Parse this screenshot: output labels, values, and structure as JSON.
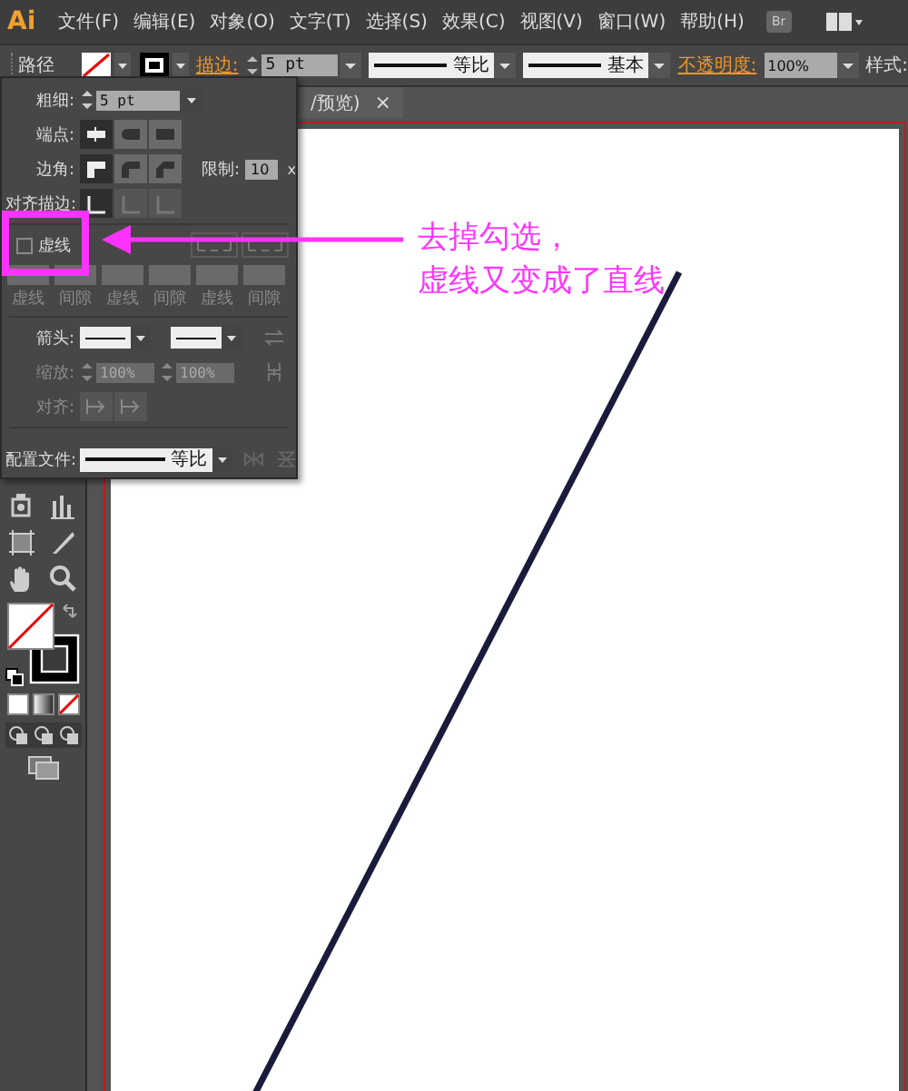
{
  "menu_bar": {
    "logo": "Ai",
    "items": [
      "文件(F)",
      "编辑(E)",
      "对象(O)",
      "文字(T)",
      "选择(S)",
      "效果(C)",
      "视图(V)",
      "窗口(W)",
      "帮助(H)"
    ],
    "bridge_button": "Br"
  },
  "control_bar": {
    "object_type": "路径",
    "stroke_label": "描边:",
    "stroke_weight": "5 pt",
    "variable_width": "等比",
    "brush": "基本",
    "opacity_label": "不透明度:",
    "opacity": "100%",
    "style_label": "样式:"
  },
  "document_tab": {
    "title": "/预览)",
    "close": "×"
  },
  "stroke_panel": {
    "weight_label": "粗细:",
    "weight": "5 pt",
    "cap_label": "端点:",
    "caps": [
      {
        "selected": true
      },
      {
        "selected": false
      },
      {
        "selected": false
      }
    ],
    "corner_label": "边角:",
    "corners": [
      {
        "selected": true
      },
      {
        "selected": false
      },
      {
        "selected": false
      }
    ],
    "limit_label": "限制:",
    "limit": "10",
    "limit_unit": "x",
    "align_label": "对齐描边:",
    "aligns": [
      {
        "selected": true,
        "disabled": false
      },
      {
        "selected": false,
        "disabled": true
      },
      {
        "selected": false,
        "disabled": true
      }
    ],
    "dashed": {
      "label": "虚线",
      "checked": false
    },
    "dash_fields": [
      {
        "label": "虚线",
        "disabled": true
      },
      {
        "label": "间隙",
        "disabled": true
      },
      {
        "label": "虚线",
        "disabled": true
      },
      {
        "label": "间隙",
        "disabled": true
      },
      {
        "label": "虚线",
        "disabled": true
      },
      {
        "label": "间隙",
        "disabled": true
      }
    ],
    "arrowheads_label": "箭头:",
    "scale_label": "缩放:",
    "scale_start": "100%",
    "scale_end": "100%",
    "arrow_align_label": "对齐:",
    "profile_label": "配置文件:",
    "profile": "等比"
  },
  "annotation": {
    "lines": [
      "去掉勾选，",
      "虚线又变成了直线"
    ]
  }
}
